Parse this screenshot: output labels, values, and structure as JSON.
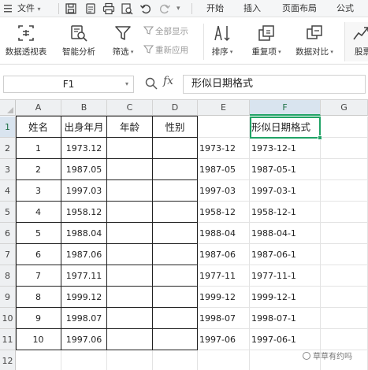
{
  "menubar": {
    "file_label": "文件",
    "tabs": [
      "开始",
      "插入",
      "页面布局",
      "公式"
    ]
  },
  "ribbon": {
    "buttons": {
      "pivot": "数据透视表",
      "smart": "智能分析",
      "filter": "筛选",
      "sort": "排序",
      "dup": "重复项",
      "compare": "数据对比",
      "cut": "股票"
    },
    "show_all": "全部显示",
    "reapply": "重新应用"
  },
  "formula_bar": {
    "cell_ref": "F1",
    "fx": "fx",
    "content": "形似日期格式"
  },
  "columns": [
    "A",
    "B",
    "C",
    "D",
    "E",
    "F",
    "G"
  ],
  "rows": [
    "1",
    "2",
    "3",
    "4",
    "5",
    "6",
    "7",
    "8",
    "9",
    "10",
    "11",
    "12"
  ],
  "sheet": {
    "headers": [
      "姓名",
      "出身年月",
      "年龄",
      "性别"
    ],
    "f1": "形似日期格式",
    "data": [
      [
        "1",
        "1973.12",
        "1973-12",
        "1973-12-1"
      ],
      [
        "2",
        "1987.05",
        "1987-05",
        "1987-05-1"
      ],
      [
        "3",
        "1997.03",
        "1997-03",
        "1997-03-1"
      ],
      [
        "4",
        "1958.12",
        "1958-12",
        "1958-12-1"
      ],
      [
        "5",
        "1988.04",
        "1988-04",
        "1988-04-1"
      ],
      [
        "6",
        "1987.06",
        "1987-06",
        "1987-06-1"
      ],
      [
        "7",
        "1977.11",
        "1977-11",
        "1977-11-1"
      ],
      [
        "8",
        "1999.12",
        "1999-12",
        "1999-12-1"
      ],
      [
        "9",
        "1998.07",
        "1998-07",
        "1998-07-1"
      ],
      [
        "10",
        "1997.06",
        "1997-06",
        "1997-06-1"
      ]
    ]
  },
  "watermark": "草草有约吗",
  "colors": {
    "accent": "#21a366",
    "header_bg": "#eef0f2",
    "selected_header_bg": "#d9e4ef"
  }
}
